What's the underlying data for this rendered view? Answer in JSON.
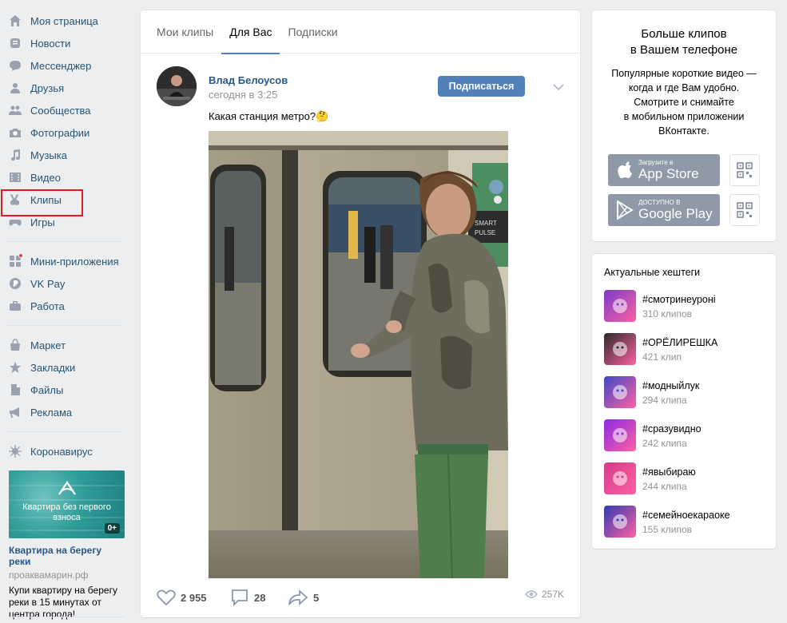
{
  "nav": {
    "items": [
      {
        "label": "Моя страница",
        "icon": "home-icon"
      },
      {
        "label": "Новости",
        "icon": "news-icon"
      },
      {
        "label": "Мессенджер",
        "icon": "messenger-icon"
      },
      {
        "label": "Друзья",
        "icon": "friends-icon"
      },
      {
        "label": "Сообщества",
        "icon": "communities-icon"
      },
      {
        "label": "Фотографии",
        "icon": "camera-icon"
      },
      {
        "label": "Музыка",
        "icon": "music-note-icon"
      },
      {
        "label": "Видео",
        "icon": "film-icon"
      },
      {
        "label": "Клипы",
        "icon": "clips-icon"
      },
      {
        "label": "Игры",
        "icon": "gamepad-icon"
      }
    ],
    "items2": [
      {
        "label": "Мини-приложения",
        "icon": "mini-apps-icon"
      },
      {
        "label": "VK Pay",
        "icon": "vk-pay-icon"
      },
      {
        "label": "Работа",
        "icon": "briefcase-icon"
      }
    ],
    "items3": [
      {
        "label": "Маркет",
        "icon": "shopping-bag-icon"
      },
      {
        "label": "Закладки",
        "icon": "star-icon"
      },
      {
        "label": "Файлы",
        "icon": "file-icon"
      },
      {
        "label": "Реклама",
        "icon": "megaphone-icon"
      }
    ],
    "items4": [
      {
        "label": "Коронавирус",
        "icon": "virus-icon"
      }
    ],
    "active_index": 8
  },
  "ad": {
    "image_caption": "Квартира без первого взноса",
    "badge": "0+",
    "title": "Квартира на берегу реки",
    "domain": "проаквамарин.рф",
    "text": "Купи квартиру на берегу реки в 15 минутах от центра города!"
  },
  "tabs": [
    "Мои клипы",
    "Для Вас",
    "Подписки"
  ],
  "active_tab": 1,
  "post": {
    "author": "Влад Белоусов",
    "time": "сегодня в 3:25",
    "subscribe_label": "Подписаться",
    "text": "Какая станция метро?🤔",
    "video_sign": "SMART\nPULSE",
    "likes": "2 955",
    "comments": "28",
    "shares": "5",
    "views": "257K"
  },
  "promo": {
    "title": "Больше клипов\nв Вашем телефоне",
    "text": "Популярные короткие видео —\nкогда и где Вам удобно.\nСмотрите и снимайте\nв мобильном приложении\nВКонтакте.",
    "appstore_small": "Загрузите в",
    "appstore_big": "App Store",
    "gplay_small": "ДОСТУПНО В",
    "gplay_big": "Google Play"
  },
  "hashtags": {
    "title": "Актуальные хештеги",
    "items": [
      {
        "tag": "#смотринеуронi",
        "count": "310 клипов",
        "color": "#7a3cc8"
      },
      {
        "tag": "#ОРЁЛИРЕШКА",
        "count": "421 клип",
        "color": "#2b2b2b"
      },
      {
        "tag": "#модныйлук",
        "count": "294 клипа",
        "color": "#3d49c9"
      },
      {
        "tag": "#сразувидно",
        "count": "242 клипа",
        "color": "#8a2be2"
      },
      {
        "tag": "#явыбираю",
        "count": "244 клипа",
        "color": "#d43c8a"
      },
      {
        "tag": "#семейноекараоке",
        "count": "155 клипов",
        "color": "#2f3bb5"
      }
    ]
  },
  "colors": {
    "link": "#2a5885",
    "accent": "#5181b8",
    "nav_text": "#285473",
    "highlight_border": "#e01c24"
  }
}
